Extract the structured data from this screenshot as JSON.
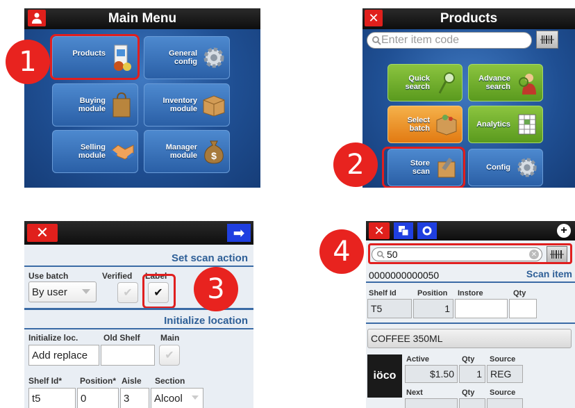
{
  "steps": [
    "1",
    "2",
    "3",
    "4"
  ],
  "main_menu": {
    "title": "Main Menu",
    "tiles": [
      {
        "label": "Products",
        "icon": "products-icon"
      },
      {
        "label": "General\nconfig",
        "icon": "gear-icon"
      },
      {
        "label": "Buying\nmodule",
        "icon": "shopping-bag-icon"
      },
      {
        "label": "Inventory\nmodule",
        "icon": "box-icon"
      },
      {
        "label": "Selling\nmodule",
        "icon": "handshake-icon"
      },
      {
        "label": "Manager\nmodule",
        "icon": "money-bag-icon"
      }
    ]
  },
  "products": {
    "title": "Products",
    "search_placeholder": "Enter item code",
    "tiles": [
      {
        "label": "Quick\nsearch",
        "color": "green"
      },
      {
        "label": "Advance\nsearch",
        "color": "green"
      },
      {
        "label": "Select\nbatch",
        "color": "orange"
      },
      {
        "label": "Analytics",
        "color": "green"
      },
      {
        "label": "Store\nscan",
        "color": "blue"
      },
      {
        "label": "Config",
        "color": "blue"
      }
    ]
  },
  "scan_action": {
    "title": "Set scan action",
    "use_batch_label": "Use batch",
    "use_batch_value": "By user",
    "verified_label": "Verified",
    "label_label": "Label",
    "init_title": "Initialize location",
    "init_loc_label": "Initialize loc.",
    "init_loc_value": "Add replace",
    "old_shelf_label": "Old Shelf",
    "main_label": "Main",
    "shelf_id_label": "Shelf Id*",
    "position_label": "Position*",
    "aisle_label": "Aisle",
    "section_label": "Section",
    "shelf_id_value": "t5",
    "position_value": "0",
    "aisle_value": "3",
    "section_value": "Alcool"
  },
  "scan_item": {
    "search_value": "50",
    "barcode": "0000000000050",
    "scan_item_title": "Scan item",
    "shelf_id_label": "Shelf Id",
    "position_label": "Position",
    "instore_label": "Instore",
    "qty_label": "Qty",
    "shelf_id_value": "T5",
    "position_value": "1",
    "product_name": "COFFEE 350ML",
    "brand_text": "iöco",
    "active_label": "Active",
    "active_qty_label": "Qty",
    "source_label": "Source",
    "active_price": "$1.50",
    "active_qty": "1",
    "active_source": "REG",
    "next_label": "Next",
    "next_qty_label": "Qty",
    "next_source_label": "Source"
  },
  "colors": {
    "highlight": "#e01f1f",
    "menu_blue": "#2a5fa6",
    "section_blue": "#2e5f97"
  }
}
